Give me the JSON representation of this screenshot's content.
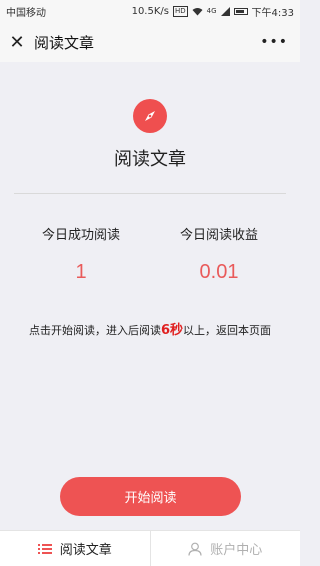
{
  "status_bar": {
    "carrier": "中国移动",
    "speed": "10.5K/s",
    "hd": "HD",
    "net": "4G",
    "time": "下午4:33"
  },
  "nav": {
    "title": "阅读文章",
    "more": "•••"
  },
  "main": {
    "headline": "阅读文章",
    "stats": [
      {
        "label": "今日成功阅读",
        "value": "1"
      },
      {
        "label": "今日阅读收益",
        "value": "0.01"
      }
    ],
    "instruction": {
      "prefix": "点击开始阅读，进入后阅读",
      "highlight": "6秒",
      "suffix": "以上，返回本页面"
    },
    "start_button": "开始阅读"
  },
  "tabs": [
    {
      "label": "阅读文章",
      "icon": "list-icon",
      "active": true
    },
    {
      "label": "账户中心",
      "icon": "user-icon",
      "active": false
    }
  ],
  "colors": {
    "accent": "#ee5353",
    "value": "#e95a5a",
    "highlight": "#e02020",
    "inactive": "#b0b0b0"
  }
}
